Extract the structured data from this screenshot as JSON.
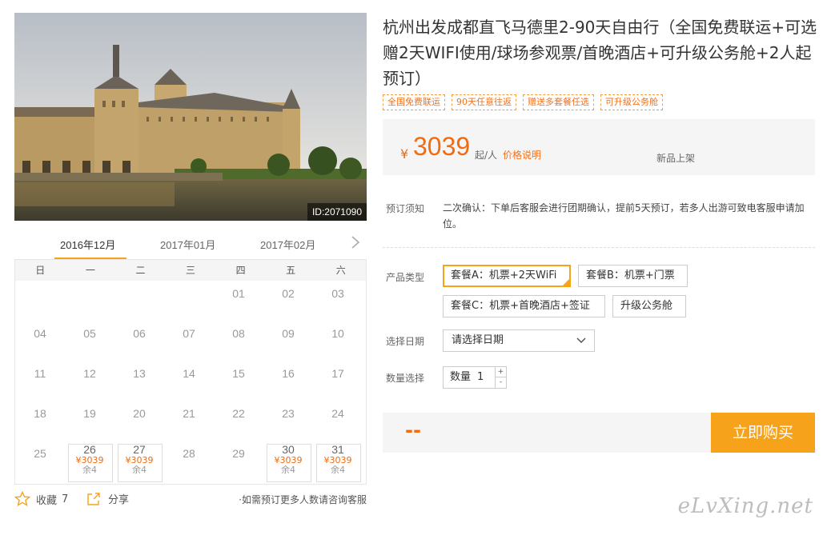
{
  "product": {
    "photo_id": "ID:2071090",
    "title": "杭州出发成都直飞马德里2-90天自由行（全国免费联运+可选赠2天WIFI使用/球场参观票/首晚酒店+可升级公务舱+2人起预订）",
    "tags": [
      "全国免费联运",
      "90天任意往返",
      "赠送多套餐任选",
      "可升级公务舱"
    ]
  },
  "price": {
    "currency": "¥",
    "value": "3039",
    "unit": "起/人",
    "explain_label": "价格说明",
    "new_label": "新品上架"
  },
  "notice": {
    "label": "预订须知",
    "text": "二次确认：下单后客服会进行团期确认，提前5天预订，若多人出游可致电客服申请加位。"
  },
  "product_type": {
    "label": "产品类型",
    "options": [
      "套餐A：机票+2天WiFi",
      "套餐B：机票+门票",
      "套餐C：机票+首晚酒店+签证",
      "升级公务舱"
    ],
    "selected_index": 0
  },
  "date_select": {
    "label": "选择日期",
    "placeholder": "请选择日期"
  },
  "quantity": {
    "label": "数量选择",
    "prefix": "数量",
    "value": "1",
    "plus": "+",
    "minus": "-"
  },
  "buy": {
    "total": "--",
    "button_label": "立即购买"
  },
  "calendar": {
    "months": [
      "2016年12月",
      "2017年01月",
      "2017年02月"
    ],
    "active_month_index": 0,
    "next_icon": "chevron-right-icon",
    "weekdays": [
      "日",
      "一",
      "二",
      "三",
      "四",
      "五",
      "六"
    ],
    "weeks": [
      [
        {
          "d": ""
        },
        {
          "d": ""
        },
        {
          "d": ""
        },
        {
          "d": ""
        },
        {
          "d": "01"
        },
        {
          "d": "02"
        },
        {
          "d": "03"
        }
      ],
      [
        {
          "d": "04"
        },
        {
          "d": "05"
        },
        {
          "d": "06"
        },
        {
          "d": "07"
        },
        {
          "d": "08"
        },
        {
          "d": "09"
        },
        {
          "d": "10"
        }
      ],
      [
        {
          "d": "11"
        },
        {
          "d": "12"
        },
        {
          "d": "13"
        },
        {
          "d": "14"
        },
        {
          "d": "15"
        },
        {
          "d": "16"
        },
        {
          "d": "17"
        }
      ],
      [
        {
          "d": "18"
        },
        {
          "d": "19"
        },
        {
          "d": "20"
        },
        {
          "d": "21"
        },
        {
          "d": "22"
        },
        {
          "d": "23"
        },
        {
          "d": "24"
        }
      ],
      [
        {
          "d": "25"
        },
        {
          "d": "26",
          "price": "¥3039",
          "stock": "余4"
        },
        {
          "d": "27",
          "price": "¥3039",
          "stock": "余4"
        },
        {
          "d": "28"
        },
        {
          "d": "29"
        },
        {
          "d": "30",
          "price": "¥3039",
          "stock": "余4"
        },
        {
          "d": "31",
          "price": "¥3039",
          "stock": "余4"
        }
      ]
    ]
  },
  "actions": {
    "favorite_label": "收藏",
    "favorite_count": "7",
    "share_label": "分享",
    "note": "·如需预订更多人数请咨询客服"
  },
  "watermark": "eLvXing.net",
  "colors": {
    "accent": "#f7a21b",
    "price": "#f26b0f",
    "panel_bg": "#f5f5f5"
  }
}
